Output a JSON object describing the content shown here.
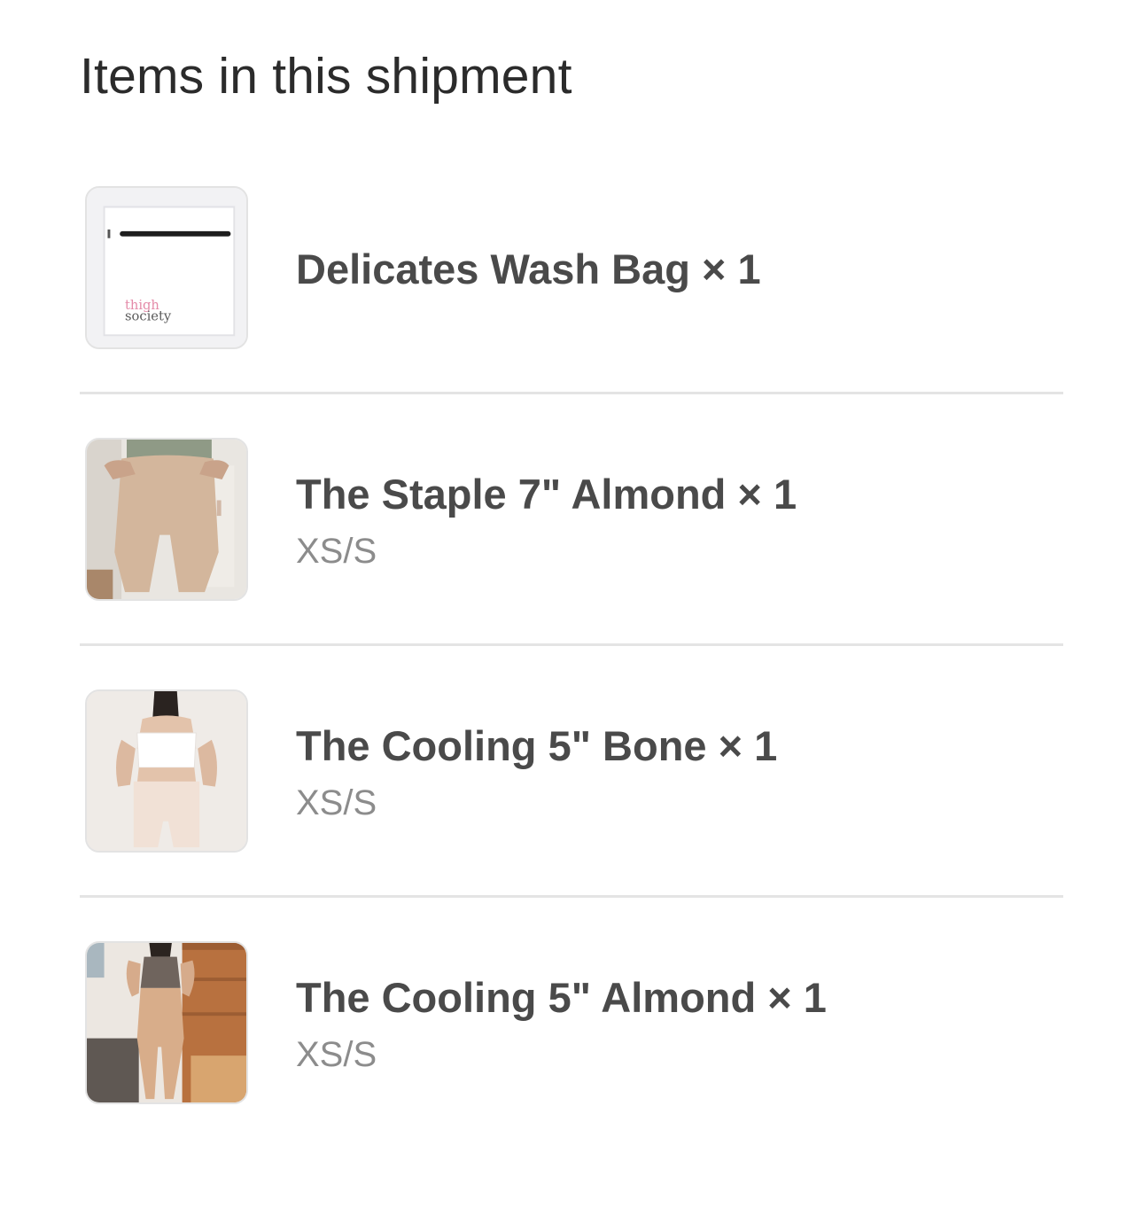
{
  "shipment": {
    "title": "Items in this shipment",
    "items": [
      {
        "name": "Delicates Wash Bag × 1",
        "variant": "",
        "image": "laundry-bag-product-image",
        "image_text": [
          "thigh",
          "society"
        ]
      },
      {
        "name": "The Staple 7\" Almond × 1",
        "variant": "XS/S",
        "image": "almond-shorts-product-image"
      },
      {
        "name": "The Cooling 5\" Bone × 1",
        "variant": "XS/S",
        "image": "bone-shorts-product-image"
      },
      {
        "name": "The Cooling 5\" Almond × 1",
        "variant": "XS/S",
        "image": "almond-cooling-shorts-product-image"
      }
    ]
  },
  "colors": {
    "title_text": "#2b2b2b",
    "item_name_text": "#4a4a4a",
    "variant_text": "#8c8c8c",
    "divider": "#e4e4e4",
    "brand_pink": "#e48aa8"
  }
}
